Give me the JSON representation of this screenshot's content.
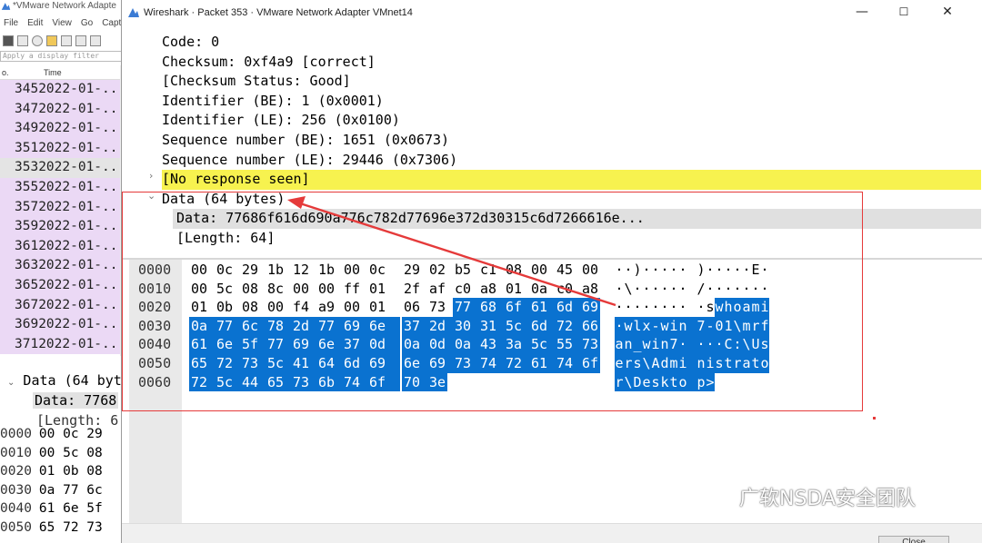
{
  "background_window": {
    "title": "*VMware Network Adapte",
    "menu": [
      "File",
      "Edit",
      "View",
      "Go",
      "Captu"
    ],
    "filter_placeholder": "Apply a display filter",
    "col_no": "o.",
    "col_time": "Time",
    "rows": [
      {
        "no": "345",
        "time": "2022-01-..."
      },
      {
        "no": "347",
        "time": "2022-01-..."
      },
      {
        "no": "349",
        "time": "2022-01-..."
      },
      {
        "no": "351",
        "time": "2022-01-..."
      },
      {
        "no": "353",
        "time": "2022-01-...",
        "selected": true
      },
      {
        "no": "355",
        "time": "2022-01-..."
      },
      {
        "no": "357",
        "time": "2022-01-..."
      },
      {
        "no": "359",
        "time": "2022-01-..."
      },
      {
        "no": "361",
        "time": "2022-01-..."
      },
      {
        "no": "363",
        "time": "2022-01-..."
      },
      {
        "no": "365",
        "time": "2022-01-..."
      },
      {
        "no": "367",
        "time": "2022-01-..."
      },
      {
        "no": "369",
        "time": "2022-01-..."
      },
      {
        "no": "371",
        "time": "2022-01-..."
      }
    ],
    "detail": {
      "line1": "Data (64 byt",
      "line2": "Data: 7768",
      "line3": "[Length: 6"
    },
    "hex": [
      {
        "off": "0000",
        "bytes": "00 0c 29"
      },
      {
        "off": "0010",
        "bytes": "00 5c 08"
      },
      {
        "off": "0020",
        "bytes": "01 0b 08"
      },
      {
        "off": "0030",
        "bytes": "0a 77 6c"
      },
      {
        "off": "0040",
        "bytes": "61 6e 5f"
      },
      {
        "off": "0050",
        "bytes": "65 72 73"
      }
    ]
  },
  "dialog": {
    "title": "Wireshark · Packet 353 · VMware Network Adapter VMnet14",
    "minimize": "—",
    "maximize": "☐",
    "close": "✕",
    "close_button_label": "Close"
  },
  "tree": {
    "code": "Code: 0",
    "checksum": "Checksum: 0xf4a9 [correct]",
    "checksum_status": "[Checksum Status: Good]",
    "id_be": "Identifier (BE): 1 (0x0001)",
    "id_le": "Identifier (LE): 256 (0x0100)",
    "seq_be": "Sequence number (BE): 1651 (0x0673)",
    "seq_le": "Sequence number (LE): 29446 (0x7306)",
    "no_response": "[No response seen]",
    "data": "Data (64 bytes)",
    "data_field": "Data: 77686f616d690a776c782d77696e372d30315c6d7266616e...",
    "length": "[Length: 64]"
  },
  "hex_rows": [
    {
      "offset": "0000",
      "bytes": [
        "00",
        "0c",
        "29",
        "1b",
        "12",
        "1b",
        "00",
        "0c",
        "29",
        "02",
        "b5",
        "c1",
        "08",
        "00",
        "45",
        "00"
      ],
      "ascii": [
        "·",
        "·",
        ")",
        "·",
        "·",
        "·",
        "·",
        "·",
        ")",
        "·",
        "·",
        "·",
        "·",
        "·",
        "E",
        "·"
      ],
      "sel_from": 16
    },
    {
      "offset": "0010",
      "bytes": [
        "00",
        "5c",
        "08",
        "8c",
        "00",
        "00",
        "ff",
        "01",
        "2f",
        "af",
        "c0",
        "a8",
        "01",
        "0a",
        "c0",
        "a8"
      ],
      "ascii": [
        "·",
        "\\",
        "·",
        "·",
        "·",
        "·",
        "·",
        "·",
        "/",
        "·",
        "·",
        "·",
        "·",
        "·",
        "·",
        "·"
      ],
      "sel_from": 16
    },
    {
      "offset": "0020",
      "bytes": [
        "01",
        "0b",
        "08",
        "00",
        "f4",
        "a9",
        "00",
        "01",
        "06",
        "73",
        "77",
        "68",
        "6f",
        "61",
        "6d",
        "69"
      ],
      "ascii": [
        "·",
        "·",
        "·",
        "·",
        "·",
        "·",
        "·",
        "·",
        "·",
        "s",
        "w",
        "h",
        "o",
        "a",
        "m",
        "i"
      ],
      "sel_from": 10
    },
    {
      "offset": "0030",
      "bytes": [
        "0a",
        "77",
        "6c",
        "78",
        "2d",
        "77",
        "69",
        "6e",
        "37",
        "2d",
        "30",
        "31",
        "5c",
        "6d",
        "72",
        "66"
      ],
      "ascii": [
        "·",
        "w",
        "l",
        "x",
        "-",
        "w",
        "i",
        "n",
        "7",
        "-",
        "0",
        "1",
        "\\",
        "m",
        "r",
        "f"
      ],
      "sel_from": 0
    },
    {
      "offset": "0040",
      "bytes": [
        "61",
        "6e",
        "5f",
        "77",
        "69",
        "6e",
        "37",
        "0d",
        "0a",
        "0d",
        "0a",
        "43",
        "3a",
        "5c",
        "55",
        "73"
      ],
      "ascii": [
        "a",
        "n",
        "_",
        "w",
        "i",
        "n",
        "7",
        "·",
        "·",
        "·",
        "·",
        "C",
        ":",
        "\\",
        "U",
        "s"
      ],
      "sel_from": 0
    },
    {
      "offset": "0050",
      "bytes": [
        "65",
        "72",
        "73",
        "5c",
        "41",
        "64",
        "6d",
        "69",
        "6e",
        "69",
        "73",
        "74",
        "72",
        "61",
        "74",
        "6f"
      ],
      "ascii": [
        "e",
        "r",
        "s",
        "\\",
        "A",
        "d",
        "m",
        "i",
        "n",
        "i",
        "s",
        "t",
        "r",
        "a",
        "t",
        "o"
      ],
      "sel_from": 0
    },
    {
      "offset": "0060",
      "bytes": [
        "72",
        "5c",
        "44",
        "65",
        "73",
        "6b",
        "74",
        "6f",
        "70",
        "3e"
      ],
      "ascii": [
        "r",
        "\\",
        "D",
        "e",
        "s",
        "k",
        "t",
        "o",
        "p",
        ">"
      ],
      "sel_from": 0
    }
  ],
  "watermark": "广软NSDA安全团队",
  "colors": {
    "selection": "#0a72d0",
    "highlight_yellow": "#f7f24f",
    "packet_row_purple": "#ebd9f5",
    "annotation_red": "#e53a3a"
  }
}
